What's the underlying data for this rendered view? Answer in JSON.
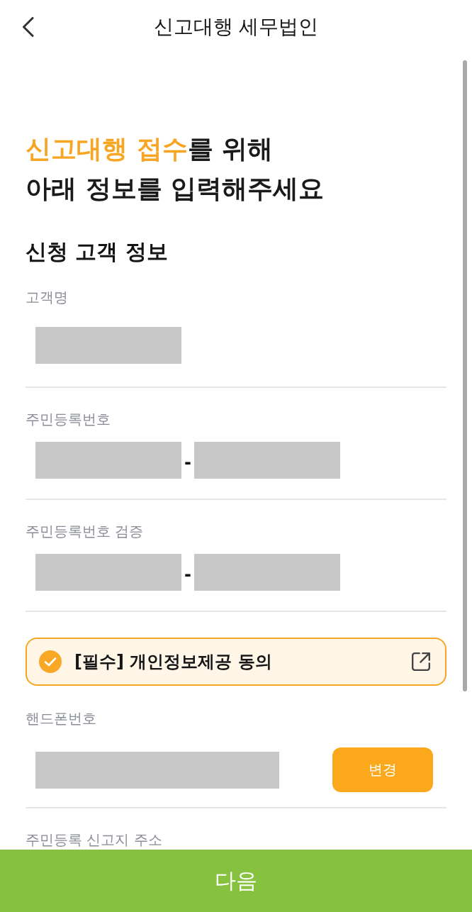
{
  "header": {
    "title": "신고대행 세무법인"
  },
  "headline": {
    "lines": [
      [
        {
          "text": "신고대행 접수",
          "highlight": true
        },
        {
          "text": "를 위해",
          "highlight": false
        }
      ],
      [
        {
          "text": "아래 정보를 입력해주세요",
          "highlight": false
        }
      ]
    ]
  },
  "section": {
    "title": "신청 고객 정보"
  },
  "form": [
    {
      "kind": "single",
      "label": "고객명"
    },
    {
      "kind": "split",
      "label": "주민등록번호",
      "separator": "-"
    },
    {
      "kind": "split",
      "label": "주민등록번호 검증",
      "separator": "-"
    },
    {
      "kind": "consent",
      "text": "[필수] 개인정보제공 동의",
      "checked": true
    },
    {
      "kind": "button_field",
      "label": "핸드폰번호",
      "button": "변경"
    },
    {
      "kind": "label",
      "label": "주민등록 신고지 주소"
    }
  ],
  "bottom_button": {
    "label": "다음"
  }
}
